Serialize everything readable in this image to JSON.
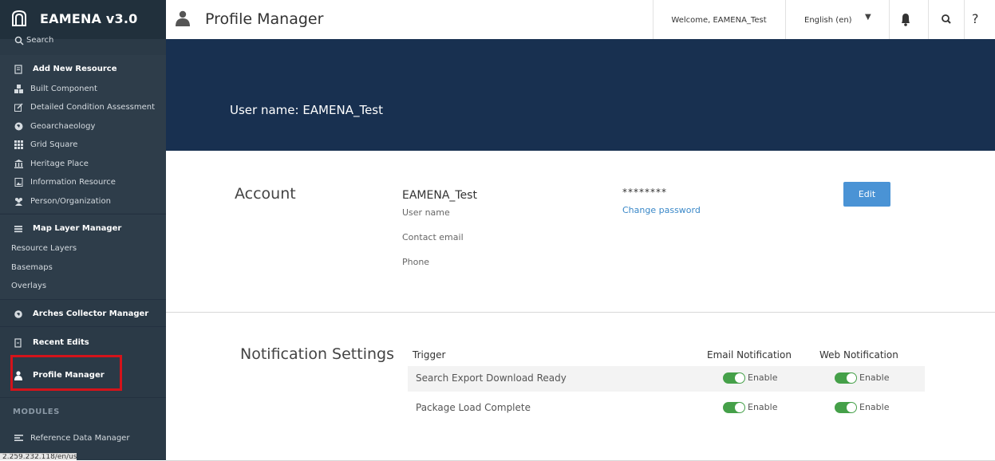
{
  "app": {
    "title": "EAMENA v3.0"
  },
  "sidebar": {
    "search_label": "Search",
    "add_new_resource": {
      "label": "Add New Resource",
      "items": [
        {
          "label": "Built Component"
        },
        {
          "label": "Detailed Condition Assessment"
        },
        {
          "label": "Geoarchaeology"
        },
        {
          "label": "Grid Square"
        },
        {
          "label": "Heritage Place"
        },
        {
          "label": "Information Resource"
        },
        {
          "label": "Person/Organization"
        }
      ]
    },
    "map_layer_manager": {
      "label": "Map Layer Manager",
      "items": [
        {
          "label": "Resource Layers"
        },
        {
          "label": "Basemaps"
        },
        {
          "label": "Overlays"
        }
      ]
    },
    "arches_collector_manager": "Arches Collector Manager",
    "recent_edits": "Recent Edits",
    "profile_manager": "Profile Manager",
    "modules_heading": "MODULES",
    "reference_data_manager": "Reference Data Manager",
    "status_url": "2.259.232.118/en/user"
  },
  "topbar": {
    "page_title": "Profile Manager",
    "welcome": "Welcome, EAMENA_Test",
    "language": "English (en)",
    "help": "?"
  },
  "banner": {
    "username_text": "User name: EAMENA_Test"
  },
  "account": {
    "heading": "Account",
    "username_value": "EAMENA_Test",
    "username_label": "User name",
    "contact_email_label": "Contact email",
    "phone_label": "Phone",
    "password_mask": "********",
    "change_password": "Change password",
    "edit_button": "Edit"
  },
  "notifications": {
    "heading": "Notification Settings",
    "columns": {
      "trigger": "Trigger",
      "email": "Email Notification",
      "web": "Web Notification"
    },
    "rows": [
      {
        "trigger": "Search Export Download Ready",
        "email": "Enable",
        "web": "Enable"
      },
      {
        "trigger": "Package Load Complete",
        "email": "Enable",
        "web": "Enable"
      }
    ]
  },
  "colors": {
    "sidebar": "#2b3a47",
    "banner": "#183050",
    "accent": "#4a93d5",
    "toggle_on": "#45a049",
    "highlight": "#d4131a"
  }
}
